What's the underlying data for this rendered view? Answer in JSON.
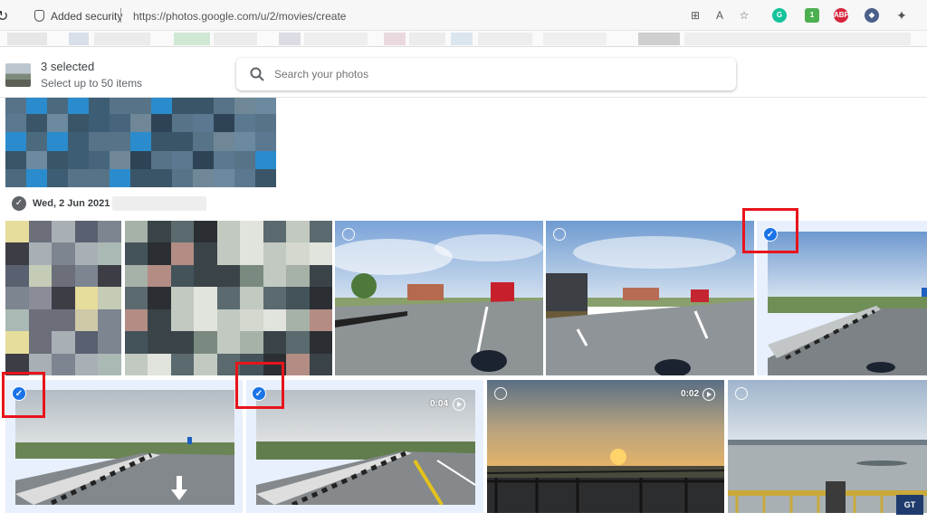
{
  "browser": {
    "security_label": "Added security",
    "url": "https://photos.google.com/u/2/movies/create",
    "toolbar_icons": [
      "split-screen-icon",
      "read-aloud-icon",
      "favorites-icon"
    ],
    "extension_icons": [
      {
        "name": "grammarly-icon",
        "color": "#15c39a",
        "text": "G"
      },
      {
        "name": "extension-badge-icon",
        "color": "#4caf50",
        "text": "1"
      },
      {
        "name": "adblock-icon",
        "color": "#d7263d",
        "text": "ABP"
      },
      {
        "name": "shield-extension-icon",
        "color": "#4a5f8a",
        "text": "◆"
      },
      {
        "name": "extensions-puzzle-icon",
        "color": "#555555",
        "text": ""
      }
    ]
  },
  "header": {
    "selected_count": "3 selected",
    "selection_hint": "Select up to 50 items",
    "search_placeholder": "Search your photos"
  },
  "date_group": {
    "label": "Wed, 2 Jun 2021"
  },
  "row1": [
    {
      "kind": "pixelated",
      "selected": false
    },
    {
      "kind": "pixelated",
      "selected": false
    },
    {
      "kind": "road-bus",
      "selected": false
    },
    {
      "kind": "road-truck",
      "selected": false
    },
    {
      "kind": "highway",
      "selected": true
    }
  ],
  "row2": [
    {
      "kind": "highway-arrow",
      "selected": true,
      "duration": ""
    },
    {
      "kind": "highway-yellow",
      "selected": true,
      "duration": "0:04"
    },
    {
      "kind": "sunset",
      "selected": false,
      "duration": "0:02"
    },
    {
      "kind": "river",
      "selected": false,
      "duration": ""
    }
  ],
  "colors": {
    "accent": "#1a73e8",
    "highlight_box": "#e8141b"
  }
}
